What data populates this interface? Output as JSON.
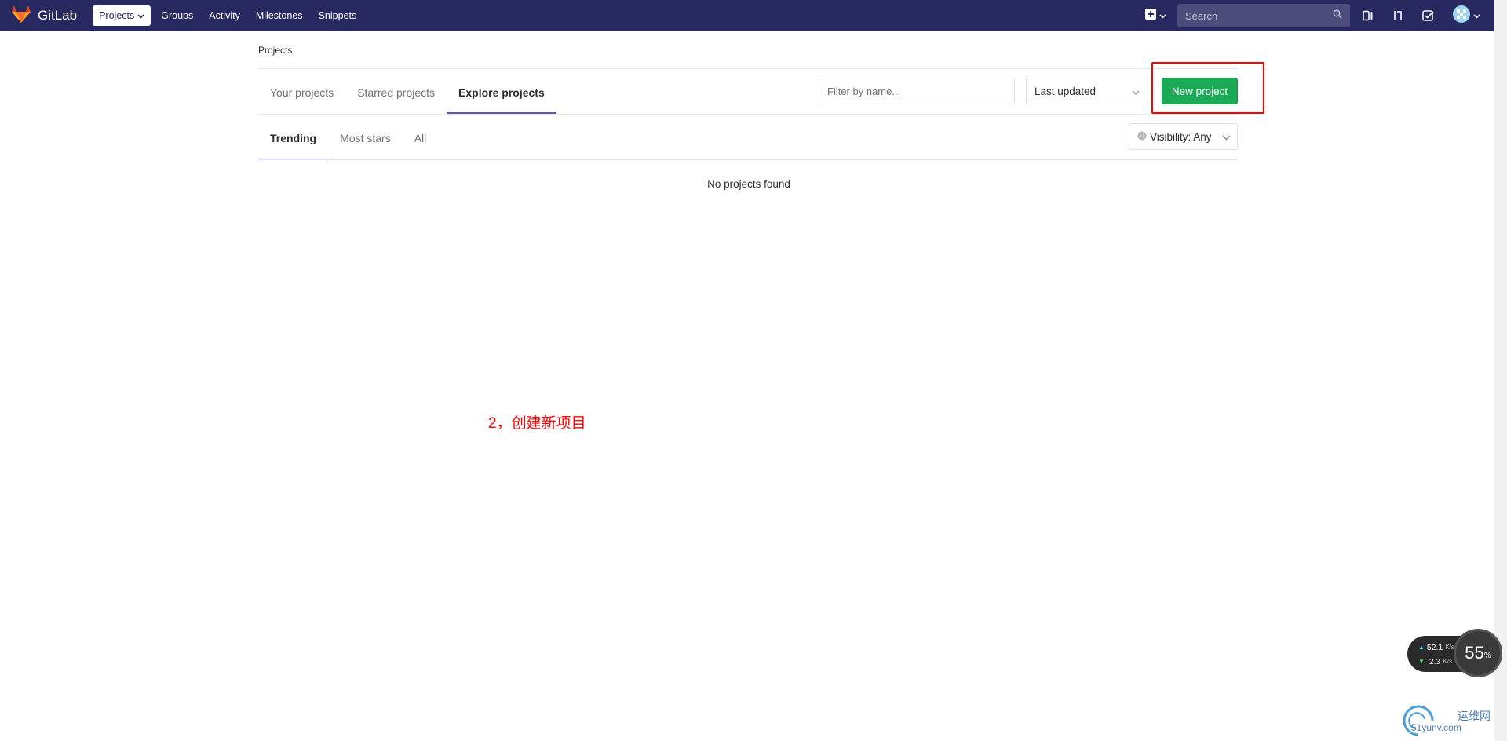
{
  "navbar": {
    "brand": "GitLab",
    "links": [
      "Projects",
      "Groups",
      "Activity",
      "Milestones",
      "Snippets"
    ],
    "search_placeholder": "Search"
  },
  "breadcrumb": "Projects",
  "scope_tabs": [
    "Your projects",
    "Starred projects",
    "Explore projects"
  ],
  "filter_placeholder": "Filter by name...",
  "sort_label": "Last updated",
  "new_project_label": "New project",
  "sub_tabs": [
    "Trending",
    "Most stars",
    "All"
  ],
  "visibility_label": "Visibility: Any",
  "empty_message": "No projects found",
  "annotation_text": "2，创建新项目",
  "speed_widget": {
    "up_value": "52.1",
    "down_value": "2.3",
    "unit": "K/s",
    "cpu_value": "55",
    "cpu_unit": "%"
  },
  "watermark": {
    "text1": "运维网",
    "text2": "51yunv.com"
  },
  "colors": {
    "navbar": "#292961",
    "accent": "#6b4fbb",
    "success": "#1aaa55",
    "annotation": "#ff0000"
  }
}
